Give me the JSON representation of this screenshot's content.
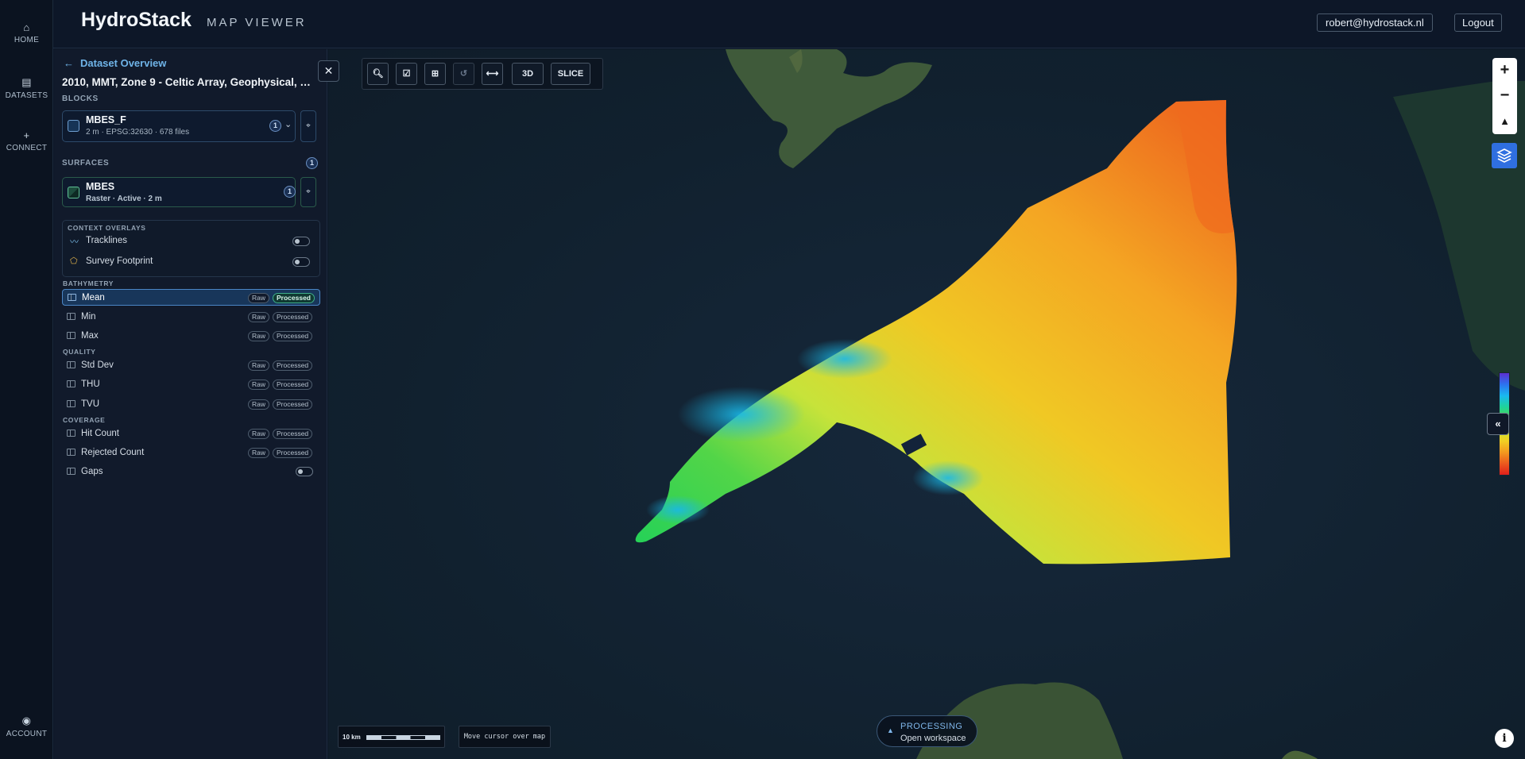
{
  "header": {
    "brand": "HydroStack",
    "subtitle": "MAP VIEWER",
    "user_email": "robert@hydrostack.nl",
    "logout_label": "Logout"
  },
  "rail": {
    "items": [
      {
        "label": "HOME",
        "icon": "home-icon"
      },
      {
        "label": "DATASETS",
        "icon": "datasets-icon"
      },
      {
        "label": "CONNECT",
        "icon": "plus-icon"
      }
    ],
    "account": {
      "label": "ACCOUNT",
      "icon": "account-icon"
    }
  },
  "panel": {
    "back_label": "Dataset Overview",
    "dataset_title": "2010, MMT, Zone 9 - Celtic Array, Geophysical, …",
    "blocks_label": "BLOCKS",
    "block": {
      "name": "MBES_F",
      "meta": "2 m · EPSG:32630 · 678 files",
      "count": "1"
    },
    "surfaces_label": "SURFACES",
    "surfaces_count": "1",
    "surface": {
      "name": "MBES",
      "meta": "Raster · Active · 2 m",
      "count": "1"
    },
    "overlays_label": "CONTEXT OVERLAYS",
    "overlays": [
      {
        "label": "Tracklines",
        "icon": "trackline-icon",
        "enabled": false
      },
      {
        "label": "Survey Footprint",
        "icon": "footprint-icon",
        "enabled": false
      }
    ],
    "groups": [
      {
        "label": "BATHYMETRY",
        "layers": [
          {
            "label": "Mean",
            "raw": "Raw",
            "processed": "Processed",
            "active": true
          },
          {
            "label": "Min",
            "raw": "Raw",
            "processed": "Processed",
            "active": false
          },
          {
            "label": "Max",
            "raw": "Raw",
            "processed": "Processed",
            "active": false
          }
        ]
      },
      {
        "label": "QUALITY",
        "layers": [
          {
            "label": "Std Dev",
            "raw": "Raw",
            "processed": "Processed",
            "active": false
          },
          {
            "label": "THU",
            "raw": "Raw",
            "processed": "Processed",
            "active": false
          },
          {
            "label": "TVU",
            "raw": "Raw",
            "processed": "Processed",
            "active": false
          }
        ]
      },
      {
        "label": "COVERAGE",
        "layers": [
          {
            "label": "Hit Count",
            "raw": "Raw",
            "processed": "Processed",
            "active": false
          },
          {
            "label": "Rejected Count",
            "raw": "Raw",
            "processed": "Processed",
            "active": false
          }
        ]
      }
    ],
    "gaps": {
      "label": "Gaps",
      "enabled": false
    }
  },
  "map": {
    "toolbar": {
      "btn_3d": "3D",
      "btn_slice": "SLICE"
    },
    "scale_label": "10 km",
    "cursor_readout": "Move cursor over map",
    "processing": {
      "title": "PROCESSING",
      "subtitle": "Open workspace"
    },
    "colors": {
      "accent": "#2f6fe0",
      "processed": "#3fae8a",
      "link": "#6fb4e8"
    }
  }
}
